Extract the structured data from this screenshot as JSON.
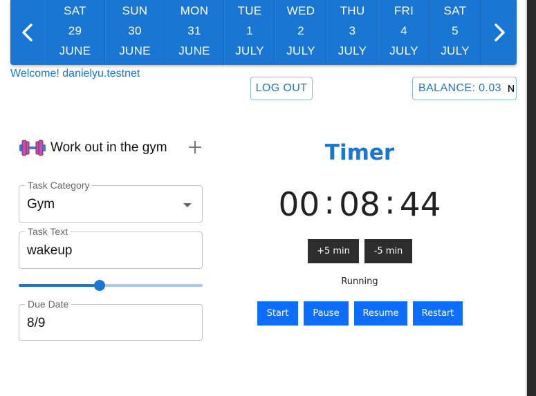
{
  "calendar": {
    "days": [
      {
        "weekday": "SAT",
        "date": "29",
        "month": "JUNE"
      },
      {
        "weekday": "SUN",
        "date": "30",
        "month": "JUNE"
      },
      {
        "weekday": "MON",
        "date": "31",
        "month": "JUNE"
      },
      {
        "weekday": "TUE",
        "date": "1",
        "month": "JULY"
      },
      {
        "weekday": "WED",
        "date": "2",
        "month": "JULY"
      },
      {
        "weekday": "THU",
        "date": "3",
        "month": "JULY"
      },
      {
        "weekday": "FRI",
        "date": "4",
        "month": "JULY"
      },
      {
        "weekday": "SAT",
        "date": "5",
        "month": "JULY"
      }
    ],
    "prev_icon": "chevron-left-icon",
    "next_icon": "chevron-right-icon",
    "color": "#1976d2"
  },
  "header": {
    "welcome": "Welcome! danielyu.testnet",
    "logout_label": "LOG OUT",
    "balance_label": "BALANCE: 0.03",
    "balance_icon": "near-token-icon"
  },
  "task": {
    "icon": "dumbbell-icon",
    "title": "Work out in the gym",
    "add_icon": "plus-icon",
    "category_label": "Task Category",
    "category_value": "Gym",
    "text_label": "Task Text",
    "text_value": "wakeup",
    "slider_fraction": 0.44,
    "due_label": "Due Date",
    "due_value": "8/9"
  },
  "timer": {
    "title": "Timer",
    "hours": "00",
    "minutes": "08",
    "seconds": "44",
    "separator": ":",
    "plus_label": "+5 min",
    "minus_label": "-5 min",
    "status": "Running",
    "start_label": "Start",
    "pause_label": "Pause",
    "resume_label": "Resume",
    "restart_label": "Restart"
  }
}
